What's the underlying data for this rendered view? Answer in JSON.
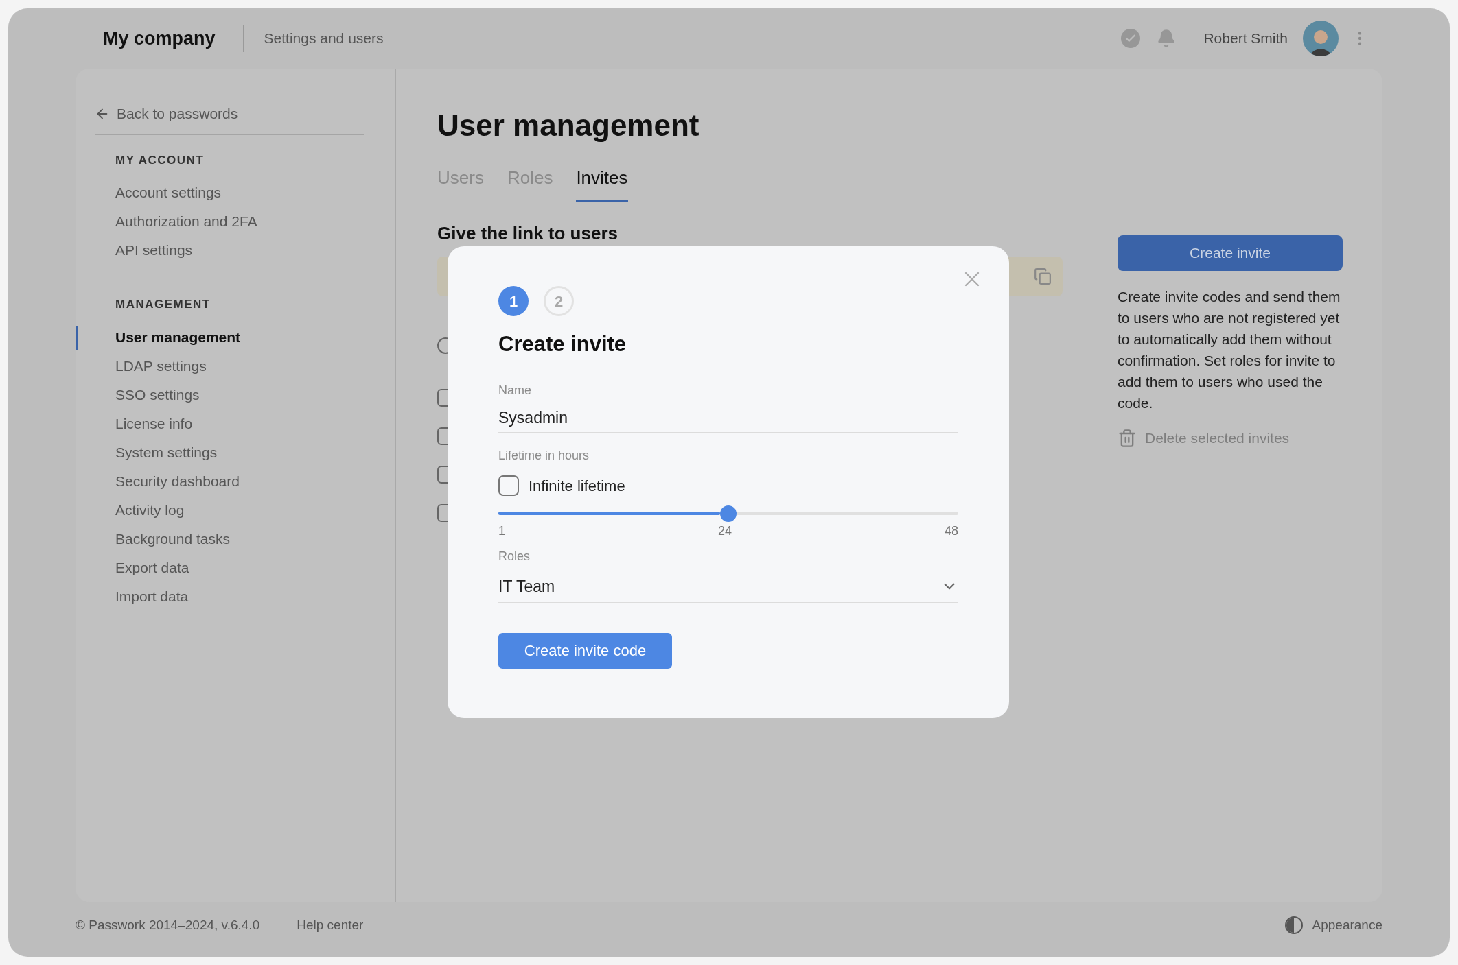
{
  "header": {
    "company": "My company",
    "section": "Settings and users",
    "user_name": "Robert Smith"
  },
  "sidebar": {
    "back_link": "Back to passwords",
    "groups": [
      {
        "title": "MY ACCOUNT",
        "items": [
          {
            "label": "Account settings",
            "selected": false
          },
          {
            "label": "Authorization and 2FA",
            "selected": false
          },
          {
            "label": "API settings",
            "selected": false
          }
        ]
      },
      {
        "title": "MANAGEMENT",
        "items": [
          {
            "label": "User management",
            "selected": true
          },
          {
            "label": "LDAP settings",
            "selected": false
          },
          {
            "label": "SSO settings",
            "selected": false
          },
          {
            "label": "License info",
            "selected": false
          },
          {
            "label": "System settings",
            "selected": false
          },
          {
            "label": "Security dashboard",
            "selected": false
          },
          {
            "label": "Activity log",
            "selected": false
          },
          {
            "label": "Background tasks",
            "selected": false
          },
          {
            "label": "Export data",
            "selected": false
          },
          {
            "label": "Import data",
            "selected": false
          }
        ]
      }
    ]
  },
  "main": {
    "title": "User management",
    "tabs": [
      {
        "label": "Users",
        "selected": false
      },
      {
        "label": "Roles",
        "selected": false
      },
      {
        "label": "Invites",
        "selected": true
      }
    ],
    "section_title": "Give the link to users",
    "select_all": {
      "checked": false
    },
    "rows": [
      {
        "checked": false
      },
      {
        "checked": false
      },
      {
        "checked": false
      },
      {
        "checked": false
      }
    ],
    "create_button": "Create invite",
    "description": "Create invite codes and send them to users who are not registered yet to automatically add them without confirmation. Set roles for invite to add them to users who used the code.",
    "delete_button": {
      "label": "Delete selected invites",
      "disabled": true
    }
  },
  "dialog": {
    "steps": [
      {
        "label": "1",
        "selected": true
      },
      {
        "label": "2",
        "selected": false
      }
    ],
    "title": "Create invite",
    "name_label": "Name",
    "name_value": "Sysadmin",
    "lifetime_label": "Lifetime in hours",
    "infinite": {
      "label": "Infinite lifetime",
      "checked": false
    },
    "slider": {
      "level": 0.5,
      "ticks": [
        "1",
        "24",
        "48"
      ]
    },
    "roles_label": "Roles",
    "roles_value": "IT Team",
    "submit": "Create invite code"
  },
  "footer": {
    "copyright": "© Passwork 2014–2024, v.6.4.0",
    "help": "Help center",
    "appearance": "Appearance"
  }
}
